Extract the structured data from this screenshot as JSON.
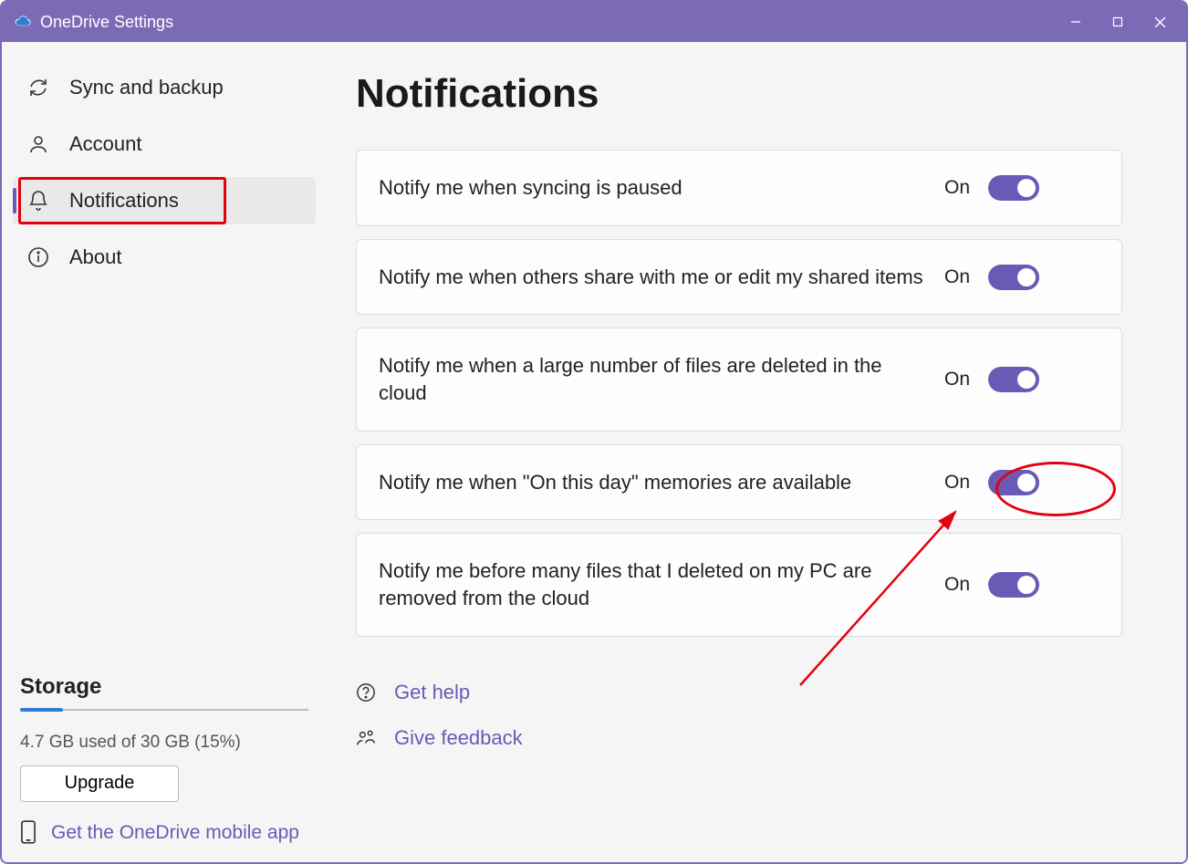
{
  "window": {
    "title": "OneDrive Settings"
  },
  "sidebar": {
    "items": [
      {
        "label": "Sync and backup"
      },
      {
        "label": "Account"
      },
      {
        "label": "Notifications"
      },
      {
        "label": "About"
      }
    ],
    "storage": {
      "heading": "Storage",
      "text": "4.7 GB used of 30 GB (15%)",
      "percent": 15,
      "upgrade": "Upgrade",
      "mobile_link": "Get the OneDrive mobile app"
    }
  },
  "main": {
    "title": "Notifications",
    "settings": [
      {
        "label": "Notify me when syncing is paused",
        "state": "On"
      },
      {
        "label": "Notify me when others share with me or edit my shared items",
        "state": "On"
      },
      {
        "label": "Notify me when a large number of files are deleted in the cloud",
        "state": "On"
      },
      {
        "label": "Notify me when \"On this day\" memories are available",
        "state": "On"
      },
      {
        "label": "Notify me before many files that I deleted on my PC are removed from the cloud",
        "state": "On"
      }
    ],
    "help": "Get help",
    "feedback": "Give feedback"
  }
}
